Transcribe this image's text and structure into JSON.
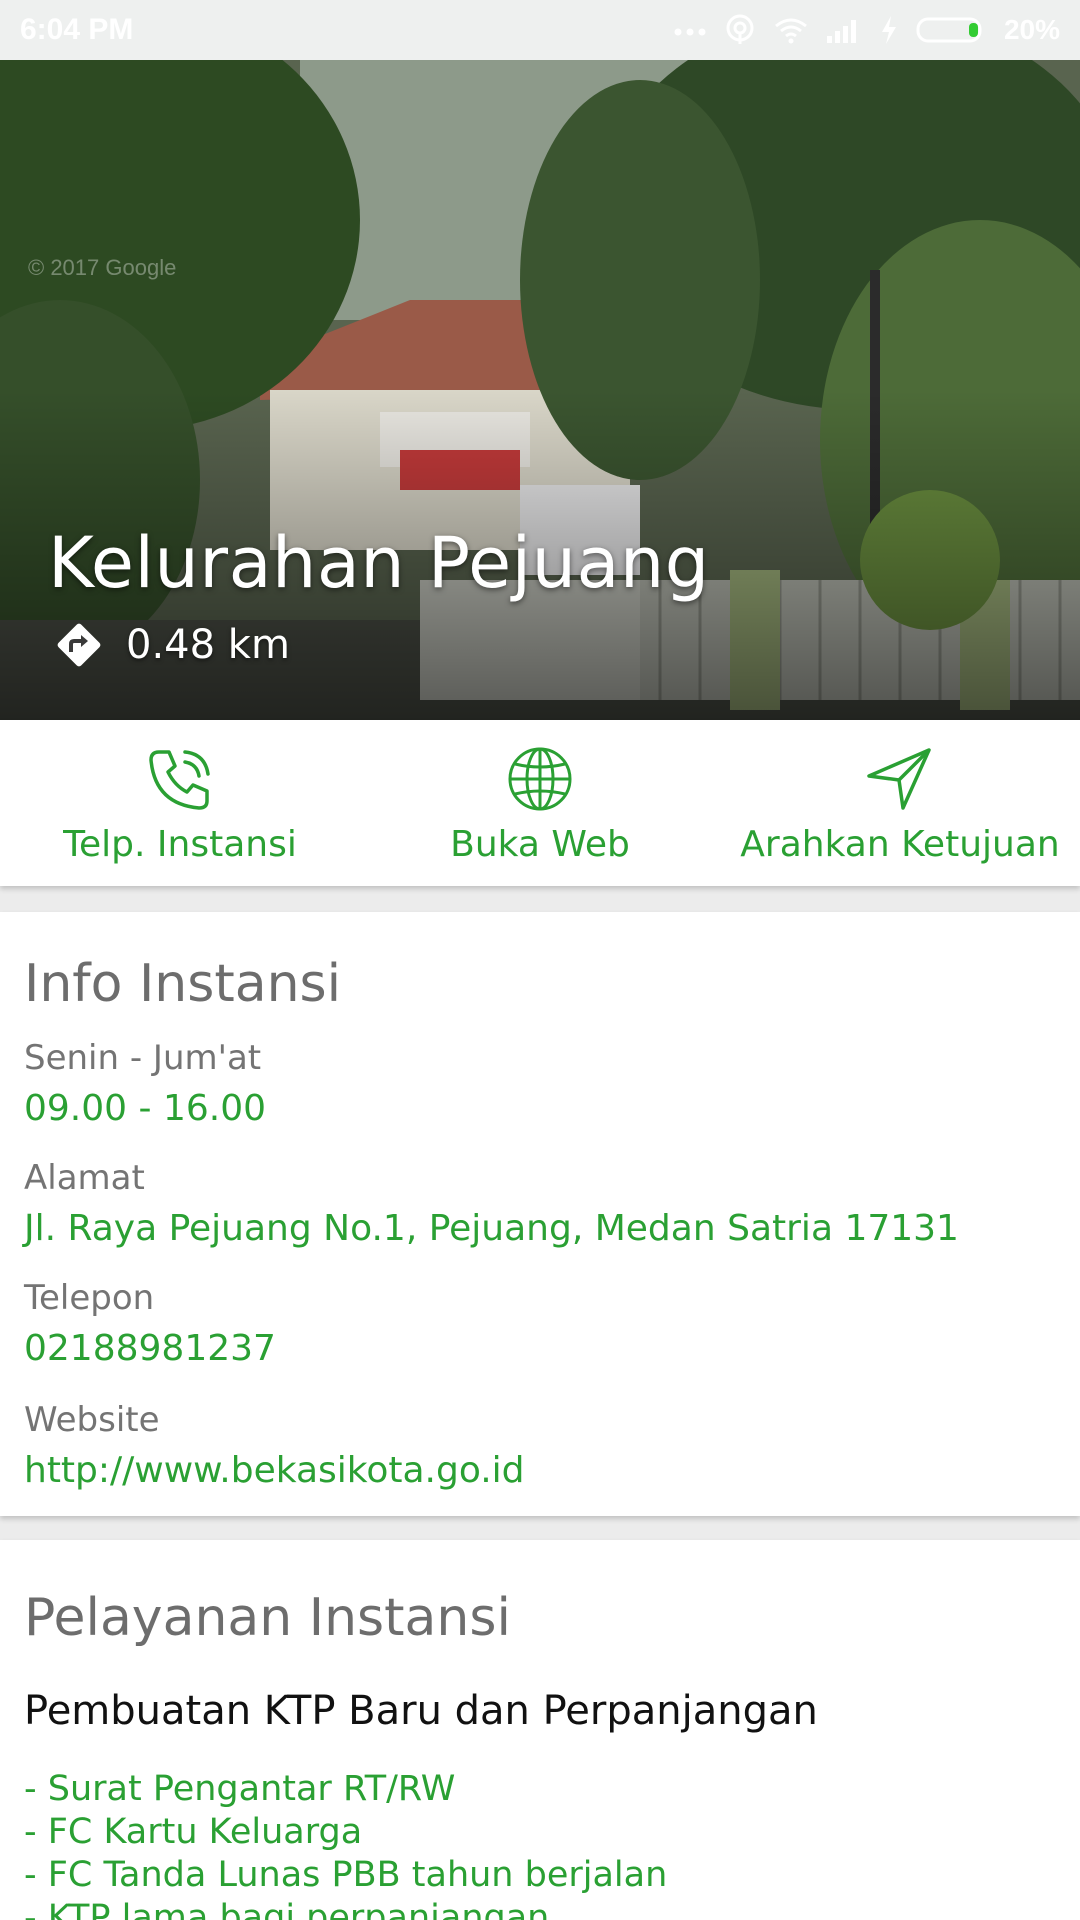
{
  "status_bar": {
    "time": "6:04 PM",
    "battery_text": "20%",
    "icons": [
      "more-dots-icon",
      "hotspot-icon",
      "wifi-icon",
      "signal-icon",
      "charging-icon",
      "battery-icon"
    ]
  },
  "hero": {
    "watermark": "© 2017 Google",
    "title": "Kelurahan Pejuang",
    "distance": "0.48 km",
    "distance_icon": "directions-icon"
  },
  "actions": [
    {
      "label": "Telp. Instansi",
      "icon": "phone-icon"
    },
    {
      "label": "Buka Web",
      "icon": "globe-icon"
    },
    {
      "label": "Arahkan Ketujuan",
      "icon": "navigate-icon"
    }
  ],
  "info": {
    "title": "Info Instansi",
    "hours_label": "Senin - Jum'at",
    "hours_value": "09.00 - 16.00",
    "address_label": "Alamat",
    "address_value": "Jl. Raya Pejuang No.1, Pejuang, Medan Satria 17131",
    "phone_label": "Telepon",
    "phone_value": "02188981237",
    "website_label": "Website",
    "website_value": "http://www.bekasikota.go.id"
  },
  "services": {
    "title": "Pelayanan Instansi",
    "service_name": "Pembuatan KTP Baru dan Perpanjangan",
    "requirements": [
      "- Surat Pengantar RT/RW",
      "- FC  Kartu Keluarga",
      "- FC Tanda Lunas PBB tahun berjalan",
      "- KTP lama bagi perpanjangan"
    ]
  },
  "colors": {
    "accent": "#2aa033",
    "muted_text": "#747474",
    "status_bar_bg": "#eef0ef"
  }
}
